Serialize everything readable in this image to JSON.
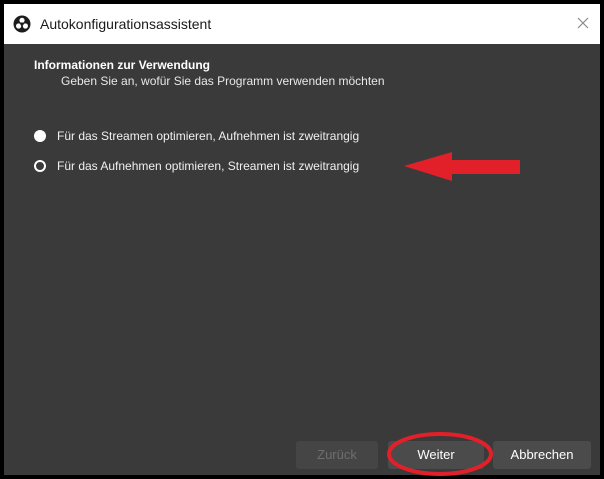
{
  "window": {
    "title": "Autokonfigurationsassistent",
    "close_glyph": "✕"
  },
  "header": {
    "title": "Informationen zur Verwendung",
    "subtitle": "Geben Sie an, wofür Sie das Programm verwenden möchten"
  },
  "options": [
    {
      "label": "Für das Streamen optimieren, Aufnehmen ist zweitrangig",
      "selected": true
    },
    {
      "label": "Für das Aufnehmen optimieren, Streamen ist zweitrangig",
      "selected": false
    }
  ],
  "buttons": {
    "back": "Zurück",
    "next": "Weiter",
    "cancel": "Abbrechen"
  },
  "annotation_color": "#e2202a",
  "icons": {
    "app": "obs-logo-icon",
    "close": "close-icon",
    "annotation": "red-arrow-icon"
  }
}
